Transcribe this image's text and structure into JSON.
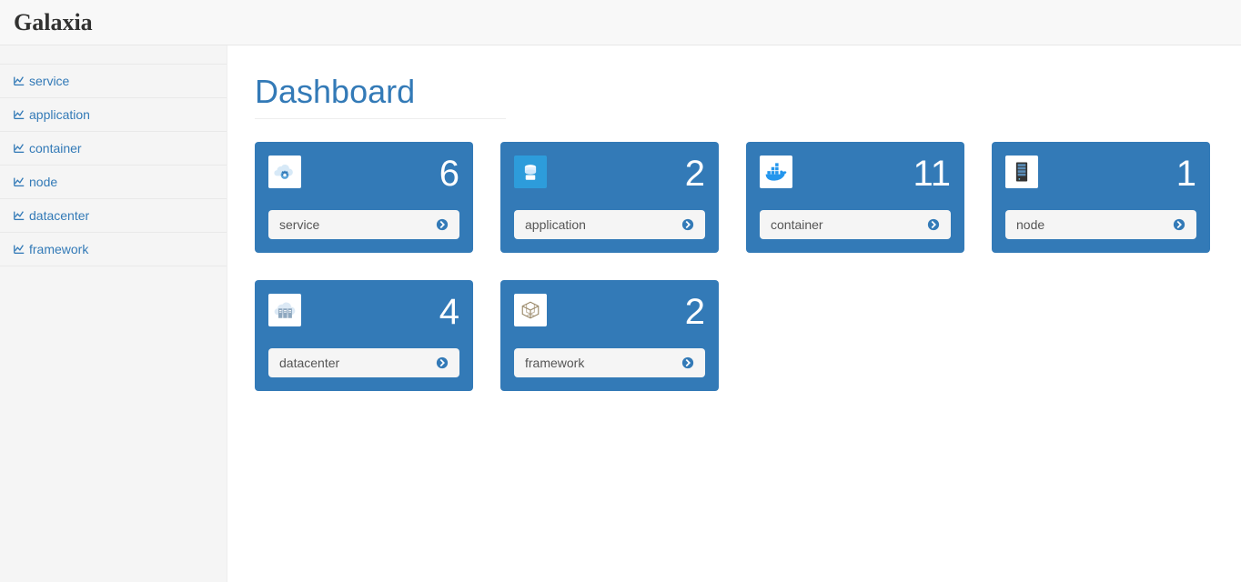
{
  "brand": "Galaxia",
  "page_title": "Dashboard",
  "sidebar": {
    "items": [
      {
        "label": "service"
      },
      {
        "label": "application"
      },
      {
        "label": "container"
      },
      {
        "label": "node"
      },
      {
        "label": "datacenter"
      },
      {
        "label": "framework"
      }
    ]
  },
  "cards": [
    {
      "label": "service",
      "value": "6",
      "icon": "gear-cloud-icon"
    },
    {
      "label": "application",
      "value": "2",
      "icon": "app-icon"
    },
    {
      "label": "container",
      "value": "11",
      "icon": "container-icon"
    },
    {
      "label": "node",
      "value": "1",
      "icon": "server-icon"
    },
    {
      "label": "datacenter",
      "value": "4",
      "icon": "datacenter-icon"
    },
    {
      "label": "framework",
      "value": "2",
      "icon": "cube-icon"
    }
  ],
  "colors": {
    "primary": "#337ab7",
    "panel_bg": "#f5f5f5"
  }
}
